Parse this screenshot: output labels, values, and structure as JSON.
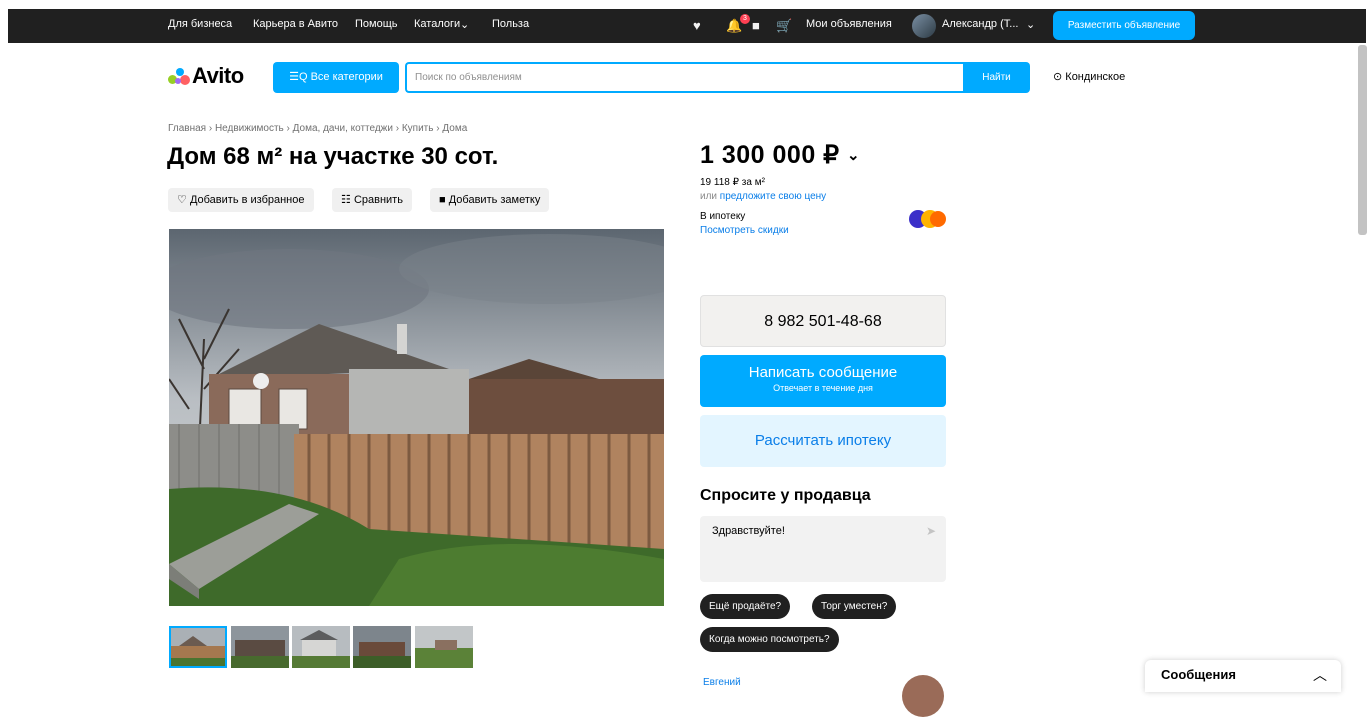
{
  "topbar": {
    "links": [
      "Для бизнеса",
      "Карьера в Авито",
      "Помощь",
      "Каталоги",
      "Польза"
    ],
    "catalog_chevron": "⌄",
    "notifications_count": "3",
    "my_ads": "Мои объявления",
    "user_name": "Александр (Т...",
    "post_ad": "Разместить объявление"
  },
  "header": {
    "logo": "Avito",
    "categories_button": "☰Q Все категории",
    "search_placeholder": "Поиск по объявлениям",
    "search_button": "Найти",
    "location": "Кондинское"
  },
  "listing": {
    "breadcrumbs": [
      "Главная",
      "Недвижимость",
      "Дома, дачи, коттеджи",
      "Купить",
      "Дома"
    ],
    "title": "Дом 68 м² на участке 30 сот.",
    "actions": {
      "favorite": "Добавить в избранное",
      "compare": "Сравнить",
      "note": "Добавить заметку"
    }
  },
  "price_block": {
    "price": "1 300 000 ₽",
    "per_meter": "19 118 ₽ за м²",
    "offer_prefix": "или",
    "offer_link": "предложите свою цену",
    "mortgage_label": "В ипотеку",
    "discounts_link": "Посмотреть скидки"
  },
  "contact": {
    "phone": "8 982 501-48-68",
    "message_button": "Написать сообщение",
    "message_sub": "Отвечает в течение дня",
    "mortgage_button": "Рассчитать ипотеку"
  },
  "ask_seller": {
    "heading": "Спросите у продавца",
    "message_text": "Здравствуйте!",
    "chips": [
      "Ещё продаёте?",
      "Торг уместен?",
      "Когда можно посмотреть?"
    ],
    "seller_name": "Евгений"
  },
  "chat_widget": {
    "label": "Сообщения"
  },
  "colors": {
    "accent": "#00aaff",
    "topbar": "#202020",
    "link": "#0a7ee8"
  }
}
